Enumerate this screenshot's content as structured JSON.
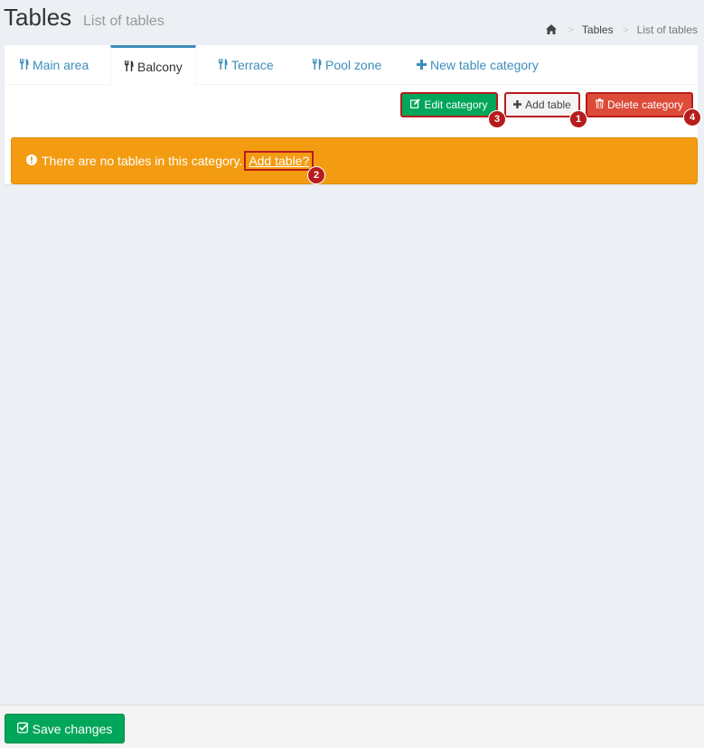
{
  "header": {
    "title": "Tables",
    "subtitle": "List of tables",
    "breadcrumb": [
      "Tables",
      "List of tables"
    ],
    "breadcrumb_sep": ">"
  },
  "tabs": [
    {
      "label": "Main area",
      "icon": "cutlery-icon",
      "active": false
    },
    {
      "label": "Balcony",
      "icon": "cutlery-icon",
      "active": true
    },
    {
      "label": "Terrace",
      "icon": "cutlery-icon",
      "active": false
    },
    {
      "label": "Pool zone",
      "icon": "cutlery-icon",
      "active": false
    },
    {
      "label": "New table category",
      "icon": "plus-icon",
      "active": false
    }
  ],
  "toolbar": {
    "edit_label": "Edit category",
    "add_label": "Add table",
    "delete_label": "Delete category"
  },
  "badges": {
    "add": "1",
    "alert_link": "2",
    "edit": "3",
    "delete": "4"
  },
  "alert": {
    "text": "There are no tables in this category.",
    "link": "Add table?"
  },
  "footer": {
    "save_label": "Save changes"
  },
  "colors": {
    "primary": "#3c8dbc",
    "success": "#00a65a",
    "danger": "#dd4b39",
    "warning": "#f39c12",
    "annotation": "#b71c1c"
  }
}
